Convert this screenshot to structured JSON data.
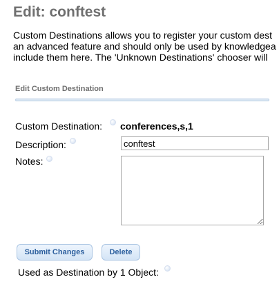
{
  "page": {
    "title": "Edit: conftest"
  },
  "intro": {
    "lines": [
      "Custom Destinations allows you to register your custom dest",
      "an advanced feature and should only be used by knowledgea",
      "include them here. The 'Unknown Destinations' chooser will"
    ]
  },
  "section": {
    "title": "Edit Custom Destination"
  },
  "form": {
    "custom_destination_label": "Custom Destination:",
    "custom_destination_value": "conferences,s,1",
    "description_label": "Description:",
    "description_value": "conftest",
    "notes_label": "Notes:",
    "notes_value": ""
  },
  "buttons": {
    "submit": "Submit Changes",
    "delete": "Delete"
  },
  "footer": {
    "used_as": "Used as Destination by 1 Object:"
  },
  "colors": {
    "title": "#6f6f6f",
    "button_text": "#2c5f9e",
    "rule": "#dbe7f3"
  }
}
